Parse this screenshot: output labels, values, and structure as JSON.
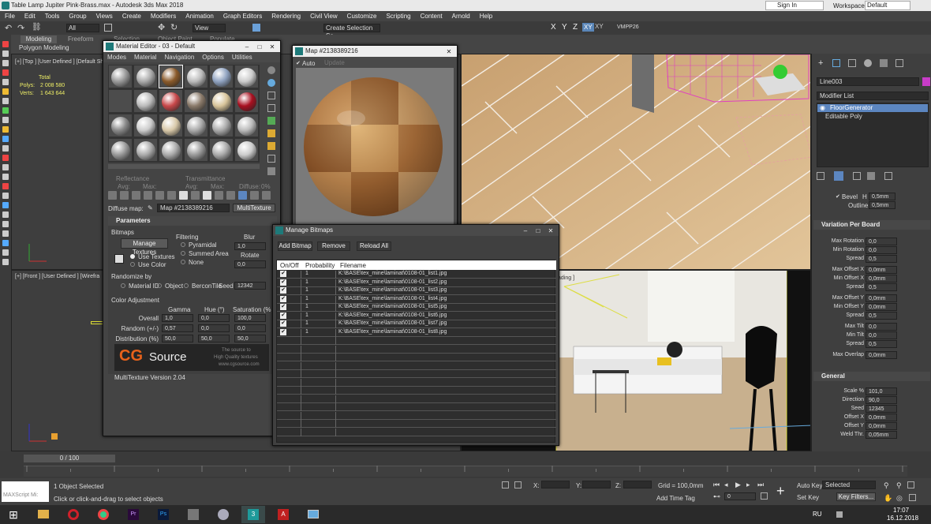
{
  "window": {
    "title": "Table Lamp Jupiter Pink-Brass.max - Autodesk 3ds Max 2018",
    "sign_in": "Sign In",
    "workspaces_label": "Workspaces:",
    "workspace": "Default"
  },
  "menu": [
    "File",
    "Edit",
    "Tools",
    "Group",
    "Views",
    "Create",
    "Modifiers",
    "Animation",
    "Graph Editors",
    "Rendering",
    "Civil View",
    "Customize",
    "Scripting",
    "Content",
    "Arnold",
    "Help"
  ],
  "toolbar": {
    "filter": "All",
    "view": "View",
    "selection_set": "Create Selection Se",
    "axes": [
      "X",
      "Y",
      "Z",
      "XY",
      "XY"
    ],
    "vmpp": "VMPP26"
  },
  "ribbon": {
    "tabs": [
      "Modeling",
      "Freeform",
      "Selection",
      "Object Paint",
      "Populate"
    ],
    "sub": "Polygon Modeling"
  },
  "viewports": {
    "top_label": "[+] [Top ] [User Defined ] [Default Shading ]",
    "stats": {
      "total": "Total",
      "polys_label": "Polys:",
      "polys": "2 008 580",
      "verts_label": "Verts:",
      "verts": "1 643 644"
    },
    "front_label": "[+] [Front ] [User Defined ] [Wirefra",
    "cam_label": "ading ]"
  },
  "material_editor": {
    "title": "Material Editor - 03 - Default",
    "menu": [
      "Modes",
      "Material",
      "Navigation",
      "Options",
      "Utilities"
    ],
    "reflectance": "Reflectance",
    "transmittance": "Transmittance",
    "avg": "Avg:",
    "max": "Max:",
    "diffuse": "Diffuse:",
    "diffuse_val": "0%",
    "diffuse_map_label": "Diffuse map:",
    "map_name": "Map #2138389216",
    "map_type": "MultiTexture",
    "params_title": "Parameters",
    "bitmaps": "Bitmaps",
    "manage_textures": "Manage Textures",
    "filtering": "Filtering",
    "pyramidal": "Pyramidal",
    "summed_area": "Summed Area",
    "none": "None",
    "blur": "Blur",
    "blur_val": "1,0",
    "rotate": "Rotate",
    "rotate_val": "0,0",
    "use_textures": "Use Textures",
    "use_color": "Use Color",
    "randomize_by": "Randomize by",
    "material_id": "Material ID",
    "object": "Object",
    "bercon": "BerconTile",
    "seed_label": "Seed",
    "seed": "12342",
    "color_adj": "Color Adjustment",
    "gamma": "Gamma",
    "hue": "Hue (°)",
    "saturation": "Saturation (%",
    "rows": [
      {
        "label": "Overall",
        "g": "1,0",
        "h": "0,0",
        "s": "100,0"
      },
      {
        "label": "Random (+/-)",
        "g": "0,57",
        "h": "0,0",
        "s": "0,0"
      },
      {
        "label": "Distribution (%)",
        "g": "50,0",
        "h": "50,0",
        "s": "50,0"
      }
    ],
    "brand_cg": "CG",
    "brand_source": "Source",
    "tagline1": "The source to",
    "tagline2": "High Quality textures",
    "tagline3": "www.cgsource.com",
    "version": "MultiTexture Version 2.04"
  },
  "map_window": {
    "title": "Map #2138389216",
    "auto": "Auto",
    "update": "Update"
  },
  "bitmap_manager": {
    "title": "Manage Bitmaps",
    "buttons": [
      "Add Bitmap",
      "Remove",
      "Reload All"
    ],
    "headers": [
      "On/Off",
      "Probability",
      "Filename"
    ],
    "rows": [
      {
        "on": "✔",
        "p": "1",
        "f": "K:\\BASE\\tex_mine\\laminat\\0108-01_list1.jpg"
      },
      {
        "on": "✔",
        "p": "1",
        "f": "K:\\BASE\\tex_mine\\laminat\\0108-01_list2.jpg"
      },
      {
        "on": "✔",
        "p": "1",
        "f": "K:\\BASE\\tex_mine\\laminat\\0108-01_list3.jpg"
      },
      {
        "on": "✔",
        "p": "1",
        "f": "K:\\BASE\\tex_mine\\laminat\\0108-01_list4.jpg"
      },
      {
        "on": "✔",
        "p": "1",
        "f": "K:\\BASE\\tex_mine\\laminat\\0108-01_list5.jpg"
      },
      {
        "on": "✔",
        "p": "1",
        "f": "K:\\BASE\\tex_mine\\laminat\\0108-01_list6.jpg"
      },
      {
        "on": "✔",
        "p": "1",
        "f": "K:\\BASE\\tex_mine\\laminat\\0108-01_list7.jpg"
      },
      {
        "on": "✔",
        "p": "1",
        "f": "K:\\BASE\\tex_mine\\laminat\\0108-01_list8.jpg"
      }
    ]
  },
  "command_panel": {
    "object_name": "Line003",
    "modifier_list": "Modifier List",
    "stack": [
      "FloorGenerator",
      "Editable Poly"
    ],
    "bevel": "Bevel",
    "h_label": "H",
    "h_val": "0,5mm",
    "outline": "Outline",
    "outline_val": "0,5mm",
    "variation_title": "Variation Per Board",
    "variation": [
      {
        "label": "Max Rotation",
        "val": "0,0"
      },
      {
        "label": "Min Rotation",
        "val": "0,0"
      },
      {
        "label": "Spread",
        "val": "0,5"
      },
      {
        "label": "Max Offset X",
        "val": "0,0mm"
      },
      {
        "label": "Min Offset X",
        "val": "0,0mm"
      },
      {
        "label": "Spread",
        "val": "0,5"
      },
      {
        "label": "Max Offset Y",
        "val": "0,0mm"
      },
      {
        "label": "Min Offset Y",
        "val": "0,0mm"
      },
      {
        "label": "Spread",
        "val": "0,5"
      },
      {
        "label": "Max Tilt",
        "val": "0,0"
      },
      {
        "label": "Min Tilt",
        "val": "0,0"
      },
      {
        "label": "Spread",
        "val": "0,5"
      },
      {
        "label": "Max Overlap",
        "val": "0,0mm"
      }
    ],
    "general_title": "General",
    "general": [
      {
        "label": "Scale %",
        "val": "101,0"
      },
      {
        "label": "Direction",
        "val": "90,0"
      },
      {
        "label": "Seed",
        "val": "12345"
      },
      {
        "label": "Offset X",
        "val": "0,0mm"
      },
      {
        "label": "Offset Y",
        "val": "0,0mm"
      },
      {
        "label": "Weld Thr.",
        "val": "0,05mm"
      }
    ]
  },
  "timeline": {
    "frame": "0 / 100"
  },
  "status": {
    "maxscript": "MAXScript Mi:",
    "selected": "1 Object Selected",
    "hint": "Click or click-and-drag to select objects",
    "x": "X:",
    "y": "Y:",
    "z": "Z:",
    "grid": "Grid = 100,0mm",
    "add_time_tag": "Add Time Tag",
    "auto_key": "Auto Key",
    "set_key": "Set Key",
    "selected_dd": "Selected",
    "key_filters": "Key Filters...",
    "frame_val": "0"
  },
  "taskbar": {
    "lang": "RU",
    "time": "17:07",
    "date": "16.12.2018"
  }
}
